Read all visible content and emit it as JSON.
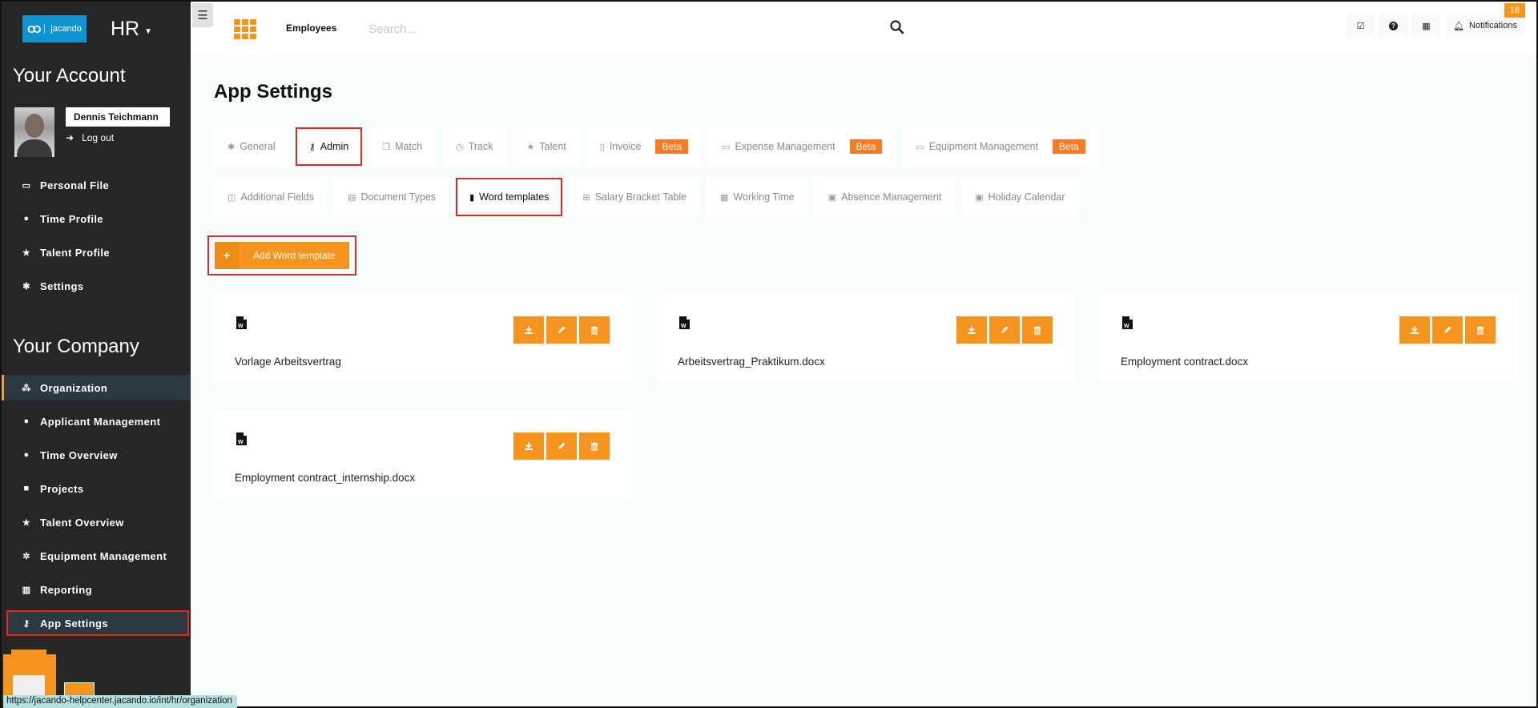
{
  "sidebar": {
    "logo_text": "jacando",
    "app_name": "HR",
    "account_title": "Your Account",
    "user_name": "Dennis Teichmann",
    "logout_label": "Log out",
    "account_items": [
      {
        "label": "Personal File",
        "icon": "id-card-icon"
      },
      {
        "label": "Time Profile",
        "icon": "clock-icon"
      },
      {
        "label": "Talent Profile",
        "icon": "star-icon"
      },
      {
        "label": "Settings",
        "icon": "gear-icon"
      }
    ],
    "company_title": "Your Company",
    "company_items": [
      {
        "label": "Organization",
        "icon": "users-icon",
        "state": "active"
      },
      {
        "label": "Applicant Management",
        "icon": "user-icon"
      },
      {
        "label": "Time Overview",
        "icon": "clock-icon"
      },
      {
        "label": "Projects",
        "icon": "briefcase-icon"
      },
      {
        "label": "Talent Overview",
        "icon": "star-icon"
      },
      {
        "label": "Equipment Management",
        "icon": "gears-icon"
      },
      {
        "label": "Reporting",
        "icon": "bar-chart-icon"
      },
      {
        "label": "App Settings",
        "icon": "key-icon",
        "state": "highlighted"
      }
    ]
  },
  "topbar": {
    "module_label": "Employees",
    "search_placeholder": "Search...",
    "notifications_label": "Notifications",
    "notifications_count": "18"
  },
  "main": {
    "title": "App Settings",
    "tabs_row1": [
      {
        "label": "General",
        "icon": "gear-icon"
      },
      {
        "label": "Admin",
        "icon": "key-icon",
        "selected": true
      },
      {
        "label": "Match",
        "icon": "windows-icon"
      },
      {
        "label": "Track",
        "icon": "clock-icon"
      },
      {
        "label": "Talent",
        "icon": "star-icon"
      },
      {
        "label": "Invoice",
        "icon": "file-icon",
        "badge": "Beta"
      },
      {
        "label": "Expense Management",
        "icon": "money-icon",
        "badge": "Beta"
      },
      {
        "label": "Equipment Management",
        "icon": "money-icon",
        "badge": "Beta"
      }
    ],
    "tabs_row2": [
      {
        "label": "Additional Fields",
        "icon": "columns-icon"
      },
      {
        "label": "Document Types",
        "icon": "document-icon"
      },
      {
        "label": "Word templates",
        "icon": "word-file-icon",
        "selected": true
      },
      {
        "label": "Salary Bracket Table",
        "icon": "table-icon"
      },
      {
        "label": "Working Time",
        "icon": "calendar-icon"
      },
      {
        "label": "Absence Management",
        "icon": "calendar-x-icon"
      },
      {
        "label": "Holiday Calendar",
        "icon": "calendar-plus-icon"
      }
    ],
    "add_button_label": "Add Word template",
    "templates": [
      {
        "name": "Vorlage Arbeitsvertrag"
      },
      {
        "name": "Arbeitsvertrag_Praktikum.docx"
      },
      {
        "name": "Employment contract.docx"
      },
      {
        "name": "Employment contract_internship.docx"
      }
    ]
  },
  "status_bar": {
    "url": "https://jacando-helpcenter.jacando.io/int/hr/organization"
  },
  "colors": {
    "accent": "#f7941d",
    "beta": "#f97b22",
    "highlight": "#e02a1a",
    "sidebar": "#262626",
    "logo": "#0f94d2"
  }
}
